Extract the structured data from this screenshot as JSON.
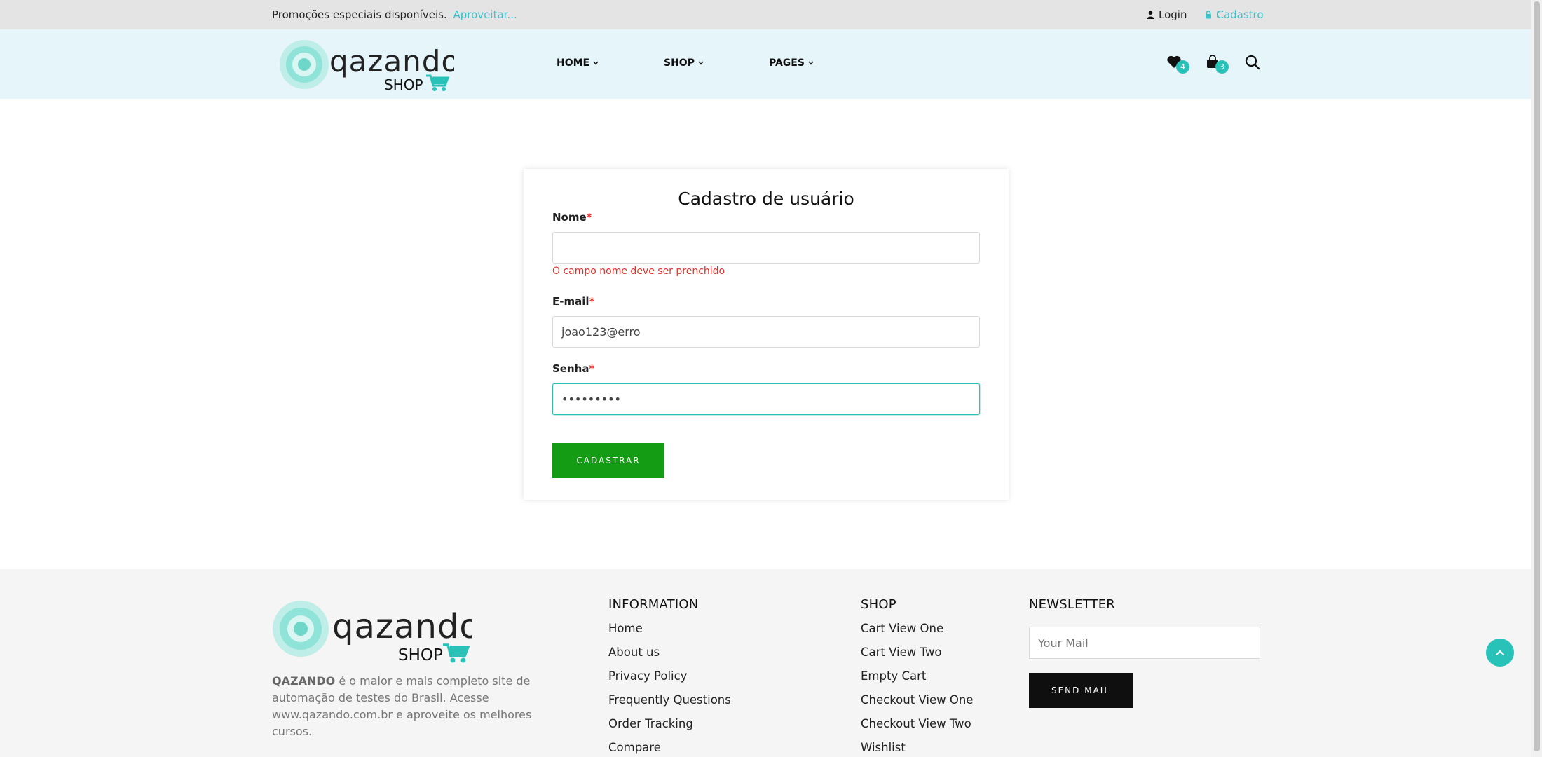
{
  "topbar": {
    "promo_text": "Promoções especiais disponíveis.",
    "promo_link": "Aproveitar...",
    "login": "Login",
    "cadastro": "Cadastro"
  },
  "header": {
    "logo_word": "qazando",
    "logo_sub": "SHOP",
    "nav": [
      "HOME",
      "SHOP",
      "PAGES"
    ],
    "wishlist_count": "4",
    "cart_count": "3"
  },
  "form": {
    "title": "Cadastro de usuário",
    "name_label": "Nome",
    "name_value": "",
    "name_error": "O campo nome deve ser prenchido",
    "email_label": "E-mail",
    "email_value": "joao123@erro",
    "password_label": "Senha",
    "password_value": "•••••••••",
    "required_mark": "*",
    "submit_label": "CADASTRAR"
  },
  "footer": {
    "logo_word": "qazando",
    "logo_sub": "SHOP",
    "desc_brand": "QAZANDO",
    "desc_text": " é o maior e mais completo site de automação de testes do Brasil. Acesse www.qazando.com.br e aproveite os melhores cursos.",
    "information": {
      "title": "INFORMATION",
      "items": [
        "Home",
        "About us",
        "Privacy Policy",
        "Frequently Questions",
        "Order Tracking",
        "Compare"
      ]
    },
    "shop": {
      "title": "SHOP",
      "items": [
        "Cart View One",
        "Cart View Two",
        "Empty Cart",
        "Checkout View One",
        "Checkout View Two",
        "Wishlist"
      ]
    },
    "newsletter": {
      "title": "NEWSLETTER",
      "placeholder": "Your Mail",
      "button": "SEND MAIL"
    }
  },
  "colors": {
    "accent": "#3cc2c8",
    "badge": "#28c2b8",
    "submit": "#149d14",
    "error": "#e0302a"
  }
}
